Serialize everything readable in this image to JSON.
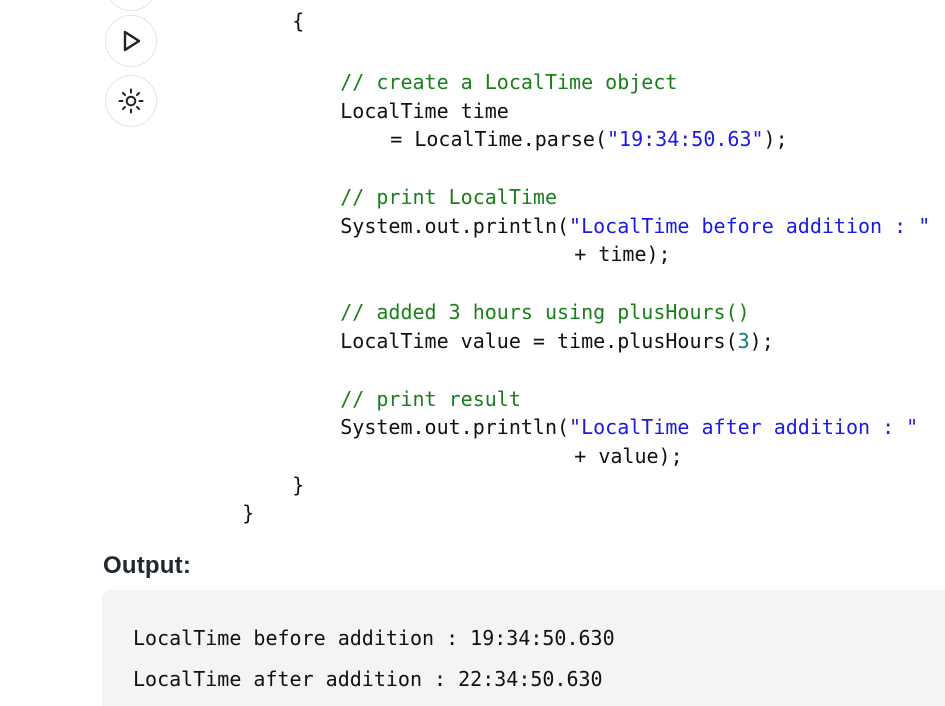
{
  "toolbar": {
    "partial_button_icon": "more-icon",
    "run_button_icon": "play-icon",
    "theme_button_icon": "sun-icon"
  },
  "code": {
    "lines": [
      "{",
      "// create a LocalTime object",
      "LocalTime time",
      "= LocalTime.parse(",
      "\"19:34:50.63\"",
      ");",
      "// print LocalTime",
      "System.out.println(",
      "\"LocalTime before addition : \"",
      "+ time);",
      "// added 3 hours using plusHours()",
      "LocalTime value = time.plusHours(",
      "3",
      ");",
      "// print result",
      "System.out.println(",
      "\"LocalTime after addition : \"",
      "+ value);",
      "}",
      "}"
    ]
  },
  "output": {
    "heading": "Output:",
    "lines": [
      "LocalTime before addition : 19:34:50.630",
      "LocalTime after addition : 22:34:50.630"
    ]
  },
  "colors": {
    "comment": "#1a7f1a",
    "string": "#1a1ae6",
    "number": "#0b7f7f",
    "text": "#111111",
    "output_background": "#f4f4f4",
    "heading": "#222831"
  }
}
